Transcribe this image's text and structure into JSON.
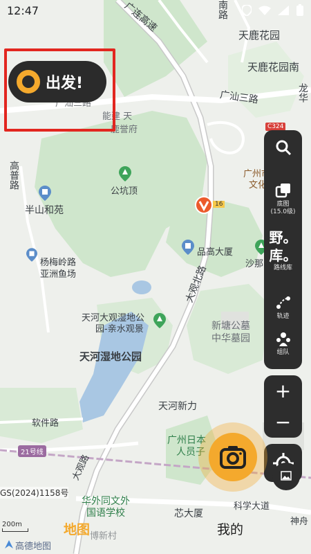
{
  "status_bar": {
    "time": "12:47"
  },
  "start_button": {
    "label": "出发!"
  },
  "toolbar": {
    "layer_label": "底图",
    "layer_level": "(15.0级)",
    "library_title": "野。",
    "library_title2": "库。",
    "library_label": "路线库",
    "track_label": "轨迹",
    "team_label": "组队"
  },
  "zoom": {
    "in": "+",
    "out": "−"
  },
  "marker_badge": "16",
  "map_labels": {
    "road_guanglian": "广连高速",
    "road_nan": "南路",
    "tianlu_garden": "天鹿花园",
    "tianlu_south": "天鹿花园南",
    "guangshan_road": "广汕三路",
    "guangshan_road_left": "广汕三路",
    "longhua": "龙华",
    "road_nan2": "华路",
    "nengjian": "能建 天",
    "tingyufu": "鹿誉府",
    "gaopu_road": "高普路",
    "banshan": "半山和苑",
    "gongkeng": "公坑顶",
    "guangzhou_tea": "广州市瑞丰茶",
    "culture": "文化博物馆",
    "c324": "C324",
    "yangmei_road": "杨梅岭路",
    "yaxiang": "亚ride鱼场",
    "pinggao": "品高大厦",
    "shana": "沙那山",
    "daguan_north": "大观北路",
    "tianhe_wetland": "天河大观湿地公",
    "park_view": "园-亲水观景",
    "tianhe_park": "天河湿地公园",
    "xintang": "新塘公墓",
    "zhonghua": "中华墓园",
    "tianhe_xinli": "天河新力",
    "software_road": "软件路",
    "line21": "21号线",
    "gz_japan": "广州日本",
    "renyuan": "人员子",
    "huawai": "华外同文外",
    "guoyu": "国语学校",
    "kexue": "科学大道",
    "xinda": "芯大厦",
    "shenzhou": "神舟",
    "daguan_road": "大观路",
    "lirunxin": "博新村"
  },
  "copyright": "GS(2024)1158号",
  "scale_label": "200m",
  "amap_logo": "高德地图",
  "tabs": {
    "map": "地图",
    "mine": "我的"
  },
  "colors": {
    "accent": "#f4a92d",
    "highlight_red": "#e2261f",
    "panel": "#2d2d2d",
    "park": "#cfe6cc",
    "water": "#a9c7e3",
    "road": "#ffffff"
  }
}
